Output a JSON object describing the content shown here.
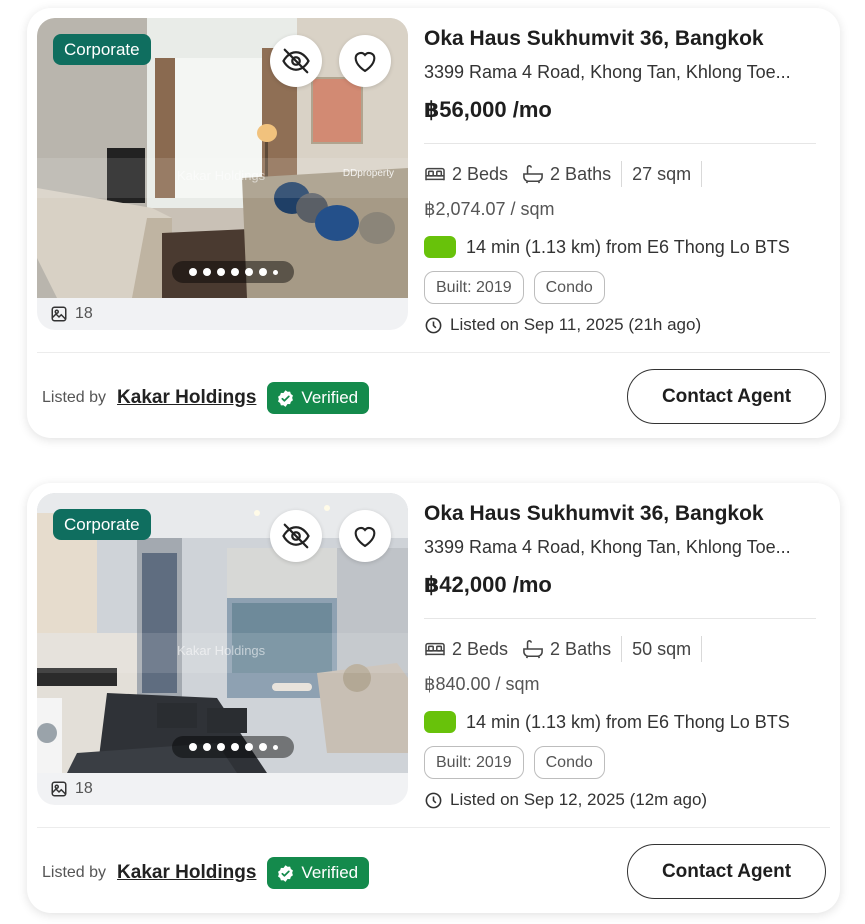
{
  "listings": [
    {
      "badge": "Corporate",
      "photo_count": "18",
      "watermark": "Kakar Holdings",
      "watermark_brand": "DDproperty",
      "title": "Oka Haus Sukhumvit 36, Bangkok",
      "address": "3399 Rama 4 Road, Khong Tan, Khlong Toe...",
      "price": "฿56,000 /mo",
      "beds": "2 Beds",
      "baths": "2 Baths",
      "area": "27 sqm",
      "price_per_sqm": "฿2,074.07 / sqm",
      "transit": "14 min (1.13 km) from E6 Thong Lo BTS",
      "tags": [
        "Built: 2019",
        "Condo"
      ],
      "listed_on": "Listed on Sep 11, 2025 (21h ago)",
      "listed_by_label": "Listed by",
      "agency": "Kakar Holdings",
      "verified": "Verified",
      "contact": "Contact Agent"
    },
    {
      "badge": "Corporate",
      "photo_count": "18",
      "watermark": "Kakar Holdings",
      "watermark_brand": "",
      "title": "Oka Haus Sukhumvit 36, Bangkok",
      "address": "3399 Rama 4 Road, Khong Tan, Khlong Toe...",
      "price": "฿42,000 /mo",
      "beds": "2 Beds",
      "baths": "2 Baths",
      "area": "50 sqm",
      "price_per_sqm": "฿840.00 / sqm",
      "transit": "14 min (1.13 km) from E6 Thong Lo BTS",
      "tags": [
        "Built: 2019",
        "Condo"
      ],
      "listed_on": "Listed on Sep 12, 2025 (12m ago)",
      "listed_by_label": "Listed by",
      "agency": "Kakar Holdings",
      "verified": "Verified",
      "contact": "Contact Agent"
    }
  ],
  "colors": {
    "corporate_badge": "#0f6e5f",
    "verified_badge": "#148a4c",
    "transit_chip": "#68c20a"
  },
  "icons": {
    "hide": "eye-off-icon",
    "favorite": "heart-icon",
    "gallery": "image-icon",
    "bed": "bed-icon",
    "bath": "bathtub-icon",
    "clock": "clock-icon",
    "verified": "verified-check-icon"
  }
}
